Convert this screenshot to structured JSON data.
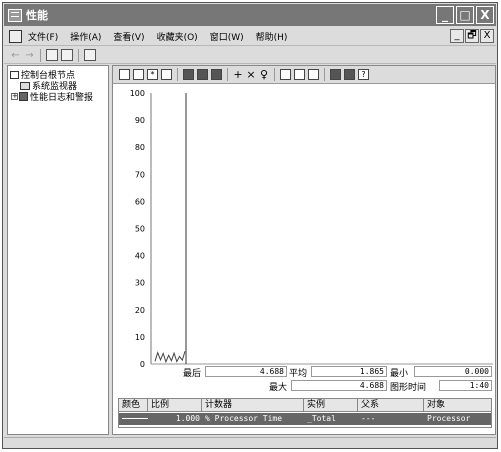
{
  "window": {
    "title": "性能"
  },
  "menu": {
    "items": [
      "文件(F)",
      "操作(A)",
      "查看(V)",
      "收藏夹(O)",
      "窗口(W)",
      "帮助(H)"
    ]
  },
  "title_buttons": {
    "minimize": "_",
    "maximize": "□",
    "close": "X"
  },
  "mdi_buttons": {
    "minimize": "_",
    "restore": "🗗",
    "close": "X"
  },
  "tree": {
    "root": "控制台根节点",
    "children": [
      "系统监视器",
      "性能日志和警报"
    ]
  },
  "graph": {
    "y_ticks": [
      "100",
      "90",
      "80",
      "70",
      "60",
      "50",
      "40",
      "30",
      "20",
      "10",
      "0"
    ]
  },
  "stats": {
    "last_label": "最后",
    "last_value": "4.688",
    "avg_label": "平均",
    "avg_value": "1.865",
    "min_label": "最小",
    "min_value": "0.000",
    "max_label": "最大",
    "max_value": "4.688",
    "duration_label": "图形时间",
    "duration_value": "1:40"
  },
  "legend": {
    "headers": [
      "颜色",
      "比例",
      "计数器",
      "实例",
      "父系",
      "对象"
    ],
    "rows": [
      {
        "scale": "1.000",
        "counter": "% Processor Time",
        "instance": "_Total",
        "parent": "---",
        "object": "Processor"
      }
    ]
  },
  "chart_data": {
    "type": "line",
    "ylim": [
      0,
      100
    ],
    "x": [
      0,
      1,
      2,
      3,
      4,
      5,
      6,
      7,
      8,
      9,
      10,
      11
    ],
    "series": [
      {
        "values": [
          1.0,
          4.2,
          1.5,
          3.9,
          0.8,
          3.2,
          1.2,
          4.0,
          0.9,
          2.8,
          1.4,
          4.688
        ]
      }
    ],
    "grid": false
  }
}
